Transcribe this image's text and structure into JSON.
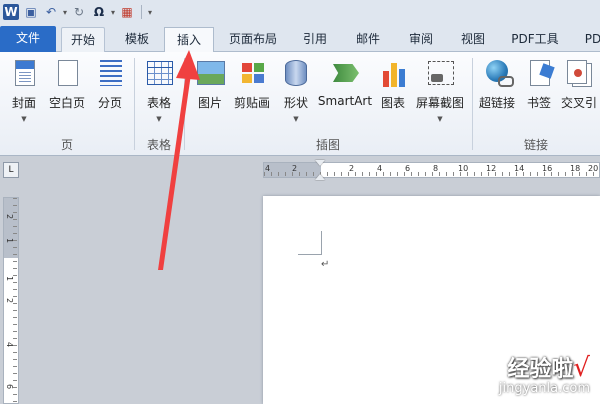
{
  "qat": {
    "logo": "W",
    "icons": [
      "save-icon",
      "undo-icon",
      "redo-icon",
      "symbol-icon",
      "customize-icon"
    ],
    "symbol_glyph": "Ω"
  },
  "tabs": [
    {
      "label": "文件"
    },
    {
      "label": "开始"
    },
    {
      "label": "模板"
    },
    {
      "label": "插入"
    },
    {
      "label": "页面布局"
    },
    {
      "label": "引用"
    },
    {
      "label": "邮件"
    },
    {
      "label": "审阅"
    },
    {
      "label": "视图"
    },
    {
      "label": "PDF工具"
    },
    {
      "label": "PD"
    }
  ],
  "ribbon": {
    "buttons": [
      {
        "label": "封面",
        "icon": "cover-page-icon"
      },
      {
        "label": "空白页",
        "icon": "blank-page-icon"
      },
      {
        "label": "分页",
        "icon": "page-break-icon"
      },
      {
        "label": "表格",
        "icon": "table-icon"
      },
      {
        "label": "图片",
        "icon": "picture-icon"
      },
      {
        "label": "剪贴画",
        "icon": "clip-art-icon"
      },
      {
        "label": "形状",
        "icon": "shapes-icon"
      },
      {
        "label": "SmartArt",
        "icon": "smartart-icon"
      },
      {
        "label": "图表",
        "icon": "chart-icon"
      },
      {
        "label": "屏幕截图",
        "icon": "screenshot-icon"
      },
      {
        "label": "超链接",
        "icon": "hyperlink-icon"
      },
      {
        "label": "书签",
        "icon": "bookmark-icon"
      },
      {
        "label": "交叉引",
        "icon": "cross-reference-icon"
      }
    ],
    "groups": [
      {
        "label": "页"
      },
      {
        "label": "表格"
      },
      {
        "label": "插图"
      },
      {
        "label": "链接"
      }
    ],
    "dropdown_glyph": "▼"
  },
  "ruler": {
    "horizontal": [
      "4",
      "2",
      "2",
      "4",
      "6",
      "8",
      "10",
      "12",
      "14",
      "16",
      "18",
      "20"
    ],
    "vertical": [
      "2",
      "1",
      "1",
      "2",
      "4",
      "6"
    ],
    "corner_glyph": "L"
  },
  "document": {
    "paragraph_mark": "↵"
  },
  "watermark": {
    "title": "经验啦",
    "check": "√",
    "url": "jingyanla.com"
  },
  "colors": {
    "file_tab": "#2a6cc7",
    "arrow": "#f04040"
  }
}
